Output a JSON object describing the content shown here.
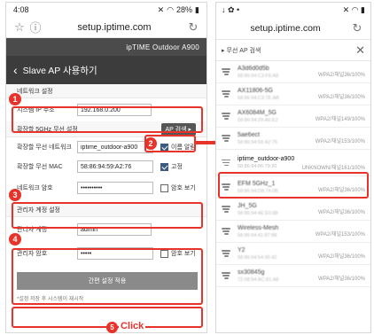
{
  "left_phone": {
    "status": {
      "time": "4:08",
      "battery": "28%"
    },
    "browser": {
      "url": "setup.iptime.com"
    },
    "brand": "ipTIME Outdoor A900",
    "page_title": "Slave AP 사용하기",
    "sections": {
      "network": "네트워크 설정",
      "wireless": "확장할 5GHz 무선 설정",
      "admin": "관리자 계정 설정"
    },
    "fields": {
      "ip_label": "시스템 IP 주소",
      "ip_value": "192.168.0.200",
      "ap_search_button": "AP 검색 ▸",
      "ssid_label": "확장할 무선 네트워크",
      "ssid_value": "iptime_outdoor-a900",
      "ssid_option": "이름 알림",
      "mac_label": "확장할 무선 MAC",
      "mac_value": "58:86:94:59:A2:76",
      "mac_option": "고정",
      "wifi_pw_label": "네트워크 암호",
      "wifi_pw_value": "••••••••••",
      "wifi_pw_option": "암호 보기",
      "admin_id_label": "관리자 계정",
      "admin_id_value": "admin",
      "admin_pw_label": "관리자 암호",
      "admin_pw_value": "•••••",
      "admin_pw_option": "암호 보기"
    },
    "apply_button": "간편 설정 적용",
    "footnote": "*설정 저장 후 시스템이 재시작",
    "annotations": {
      "b1": "1",
      "b2": "2",
      "b3": "3",
      "b4": "4",
      "b5": "5",
      "click": "Click"
    }
  },
  "right_phone": {
    "browser": {
      "url": "setup.iptime.com"
    },
    "panel_title": "▸ 무선 AP 검색",
    "aps": [
      {
        "name": "A3d6d0d5b",
        "mac": "58:86:94:C3:F6:A8",
        "security": "WPA2/채널36/100%"
      },
      {
        "name": "AX11806-5G",
        "mac": "58:86:94:C3:7E:AB",
        "security": "WPA2/채널36/100%"
      },
      {
        "name": "AX6084M_5G",
        "mac": "58:86:94:29:A6:E2",
        "security": "WPA2/채널149/100%"
      },
      {
        "name": "5ae6ect",
        "mac": "58:86:94:58:A2:76",
        "security": "WPA2/채널153/100%"
      },
      {
        "name": "iptime_outdoor-a900",
        "mac": "58:86:94:86:79:20",
        "security": "UNKNOWN/채널161/100%"
      },
      {
        "name": "EFM 5GHz_1",
        "mac": "58:86:94:D8:74:0B",
        "security": "WPA2/채널36/100%"
      },
      {
        "name": "JH_5G",
        "mac": "58:86:94:4E:E0:88",
        "security": "WPA2/채널36/100%"
      },
      {
        "name": "Wireless-Mesh",
        "mac": "58:86:94:41:87:88",
        "security": "WPA2/채널153/100%"
      },
      {
        "name": "Y2",
        "mac": "58:86:94:54:95:42",
        "security": "WPA2/채널36/100%"
      },
      {
        "name": "sx30845g",
        "mac": "72:08:94:AC:81:A8",
        "security": "WPA2/채널36/100%"
      }
    ]
  },
  "colors": {
    "accent_red": "#e8332a",
    "header_dark": "#3c3c3c",
    "button_gray": "#8a8a8a"
  }
}
